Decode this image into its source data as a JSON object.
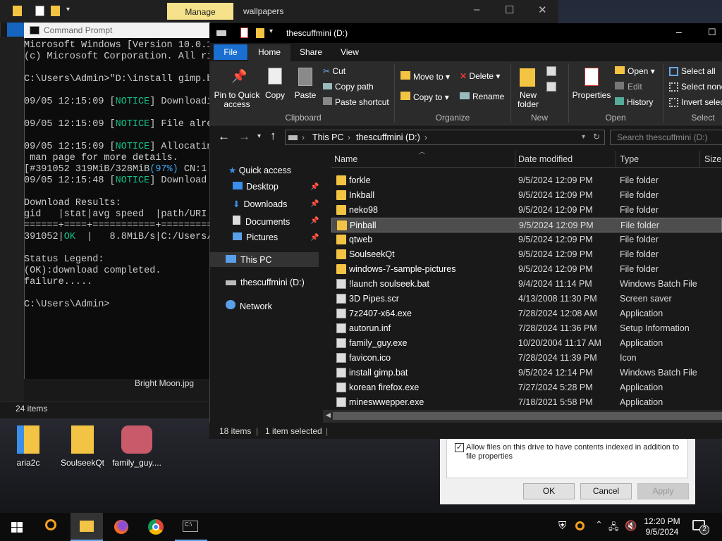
{
  "background_window": {
    "manage_tab": "Manage",
    "title": "wallpapers",
    "items_count": "24 items",
    "bright_moon_label": "Bright Moon.jpg"
  },
  "cmd": {
    "title": "Command Prompt",
    "lines": [
      "Microsoft Windows [Version 10.0.1",
      "(c) Microsoft Corporation. All ri",
      "",
      "C:\\Users\\Admin>\"D:\\install gimp.b",
      "",
      "09/05 12:15:09 [NOTICE] Downloadi",
      "",
      "09/05 12:15:09 [NOTICE] File alre",
      "",
      "09/05 12:15:09 [NOTICE] Allocatin",
      " man page for more details.",
      "[#391052 319MiB/328MiB(97%) CN:1",
      "09/05 12:15:48 [NOTICE] Download",
      "",
      "Download Results:",
      "gid   |stat|avg speed  |path/URI",
      "======+====+===========+=========",
      "391052|OK  |   8.8MiB/s|C:/Users/",
      "",
      "Status Legend:",
      "(OK):download completed.",
      "failure.....",
      "",
      "C:\\Users\\Admin>"
    ]
  },
  "explorer": {
    "title": "thescuffmini (D:)",
    "tabs": {
      "file": "File",
      "home": "Home",
      "share": "Share",
      "view": "View"
    },
    "ribbon": {
      "pin": "Pin to Quick access",
      "copy": "Copy",
      "paste": "Paste",
      "cut": "Cut",
      "copy_path": "Copy path",
      "paste_shortcut": "Paste shortcut",
      "move_to": "Move to",
      "copy_to": "Copy to",
      "delete": "Delete",
      "rename": "Rename",
      "new_folder": "New folder",
      "properties": "Properties",
      "open": "Open",
      "edit": "Edit",
      "history": "History",
      "select_all": "Select all",
      "select_none": "Select none",
      "invert_selection": "Invert selec",
      "groups": {
        "clipboard": "Clipboard",
        "organize": "Organize",
        "new": "New",
        "open": "Open",
        "select": "Select"
      }
    },
    "address": {
      "this_pc": "This PC",
      "drive": "thescuffmini (D:)",
      "search_placeholder": "Search thescuffmini (D:)"
    },
    "nav": {
      "quick_access": "Quick access",
      "desktop": "Desktop",
      "downloads": "Downloads",
      "documents": "Documents",
      "pictures": "Pictures",
      "this_pc": "This PC",
      "drive": "thescuffmini (D:)",
      "network": "Network"
    },
    "columns": {
      "name": "Name",
      "date": "Date modified",
      "type": "Type",
      "size": "Size"
    },
    "files": [
      {
        "name": "forkle",
        "date": "9/5/2024 12:09 PM",
        "type": "File folder",
        "kind": "folder"
      },
      {
        "name": "Inkball",
        "date": "9/5/2024 12:09 PM",
        "type": "File folder",
        "kind": "folder"
      },
      {
        "name": "neko98",
        "date": "9/5/2024 12:09 PM",
        "type": "File folder",
        "kind": "folder"
      },
      {
        "name": "Pinball",
        "date": "9/5/2024 12:09 PM",
        "type": "File folder",
        "kind": "folder",
        "selected": true
      },
      {
        "name": "qtweb",
        "date": "9/5/2024 12:09 PM",
        "type": "File folder",
        "kind": "folder"
      },
      {
        "name": "SoulseekQt",
        "date": "9/5/2024 12:09 PM",
        "type": "File folder",
        "kind": "folder"
      },
      {
        "name": "windows-7-sample-pictures",
        "date": "9/5/2024 12:09 PM",
        "type": "File folder",
        "kind": "folder"
      },
      {
        "name": "!launch soulseek.bat",
        "date": "9/4/2024 11:14 PM",
        "type": "Windows Batch File",
        "kind": "file"
      },
      {
        "name": "3D Pipes.scr",
        "date": "4/13/2008 11:30 PM",
        "type": "Screen saver",
        "kind": "file"
      },
      {
        "name": "7z2407-x64.exe",
        "date": "7/28/2024 12:08 AM",
        "type": "Application",
        "kind": "file"
      },
      {
        "name": "autorun.inf",
        "date": "7/28/2024 11:36 PM",
        "type": "Setup Information",
        "kind": "file"
      },
      {
        "name": "family_guy.exe",
        "date": "10/20/2004 11:17 AM",
        "type": "Application",
        "kind": "file"
      },
      {
        "name": "favicon.ico",
        "date": "7/28/2024 11:39 PM",
        "type": "Icon",
        "kind": "file"
      },
      {
        "name": "install gimp.bat",
        "date": "9/5/2024 12:14 PM",
        "type": "Windows Batch File",
        "kind": "file"
      },
      {
        "name": "korean firefox.exe",
        "date": "7/27/2024 5:28 PM",
        "type": "Application",
        "kind": "file"
      },
      {
        "name": "mineswwepper.exe",
        "date": "7/18/2021 5:58 PM",
        "type": "Application",
        "kind": "file"
      }
    ],
    "status": {
      "count": "18 items",
      "selected": "1 item selected"
    }
  },
  "properties_dialog": {
    "checkbox_label": "Allow files on this drive to have contents indexed in addition to file properties",
    "ok": "OK",
    "cancel": "Cancel",
    "apply": "Apply"
  },
  "desktop_icons": [
    "aria2c",
    "SoulseekQt",
    "family_guy...."
  ],
  "taskbar": {
    "time": "12:20 PM",
    "date": "9/5/2024",
    "notifications": "2"
  },
  "colors": {
    "notice": "#13c08a",
    "accent": "#1a6fd1",
    "folder": "#f3c343"
  }
}
